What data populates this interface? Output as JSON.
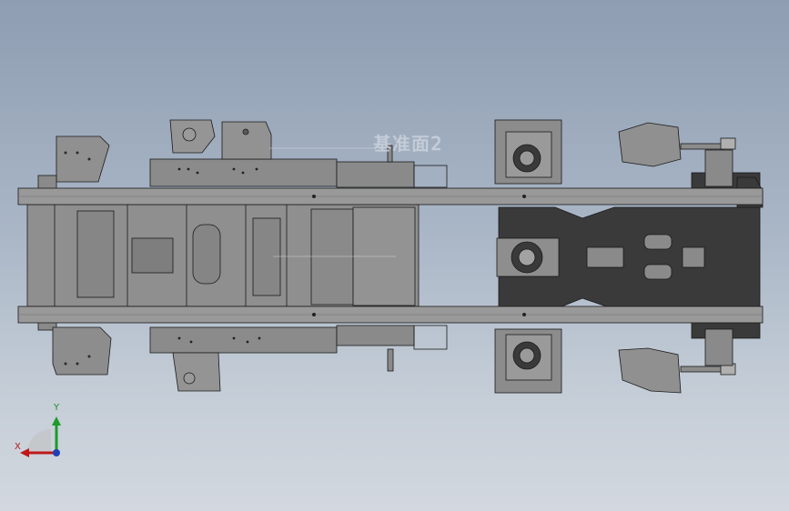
{
  "viewport": {
    "background_top": "#8e9db2",
    "background_bottom": "#d3d8df"
  },
  "annotation": {
    "reference_plane_label": "基准面2"
  },
  "triad": {
    "x_label": "X",
    "y_label": "Y",
    "x_color": "#c01818",
    "y_color": "#1c9a2b",
    "z_color": "#1f3fb5"
  },
  "model": {
    "line_color": "#1a1a1a",
    "body_fill": "#8c8c8c",
    "dark_fill": "#3a3a3a"
  }
}
